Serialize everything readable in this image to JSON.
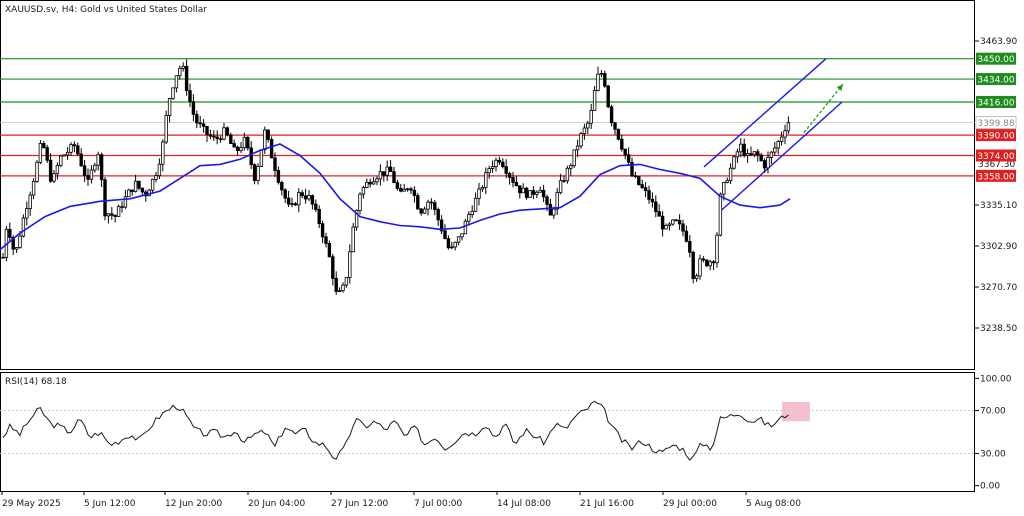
{
  "chart_data": {
    "type": "candlestick",
    "symbol_title": "XAUUSD.sv, H4:  Gold vs United States Dollar",
    "price_axis": {
      "ylim": [
        3206.3,
        3496.1
      ],
      "ticks": [
        "3463.90",
        "3335.10",
        "3302.90",
        "3270.70",
        "3238.50"
      ],
      "extra_ticks": [
        {
          "value": 3367.3,
          "label": "3367.30"
        }
      ]
    },
    "time_axis": {
      "labels": [
        "29 May 2025",
        "5 Jun 12:00",
        "12 Jun 20:00",
        "20 Jun 04:00",
        "27 Jun 12:00",
        "7 Jul 00:00",
        "14 Jul 08:00",
        "21 Jul 16:00",
        "29 Jul 00:00",
        "5 Aug 08:00"
      ]
    },
    "levels": {
      "resistance": [
        {
          "value": 3450.0,
          "label": "3450.00",
          "color": "#1e8c1e"
        },
        {
          "value": 3434.0,
          "label": "3434.00",
          "color": "#1e8c1e"
        },
        {
          "value": 3416.0,
          "label": "3416.00",
          "color": "#1e8c1e"
        }
      ],
      "support": [
        {
          "value": 3390.0,
          "label": "3390.00",
          "color": "#e02020"
        },
        {
          "value": 3374.0,
          "label": "3374.00",
          "color": "#e02020"
        },
        {
          "value": 3358.0,
          "label": "3358.00",
          "color": "#e02020"
        }
      ],
      "current": {
        "value": 3399.88,
        "label": "3399.88",
        "color": "#c0c0c0"
      }
    },
    "price_path": [
      [
        0,
        3273
      ],
      [
        7,
        3322
      ],
      [
        15,
        3295
      ],
      [
        25,
        3330
      ],
      [
        35,
        3360
      ],
      [
        42,
        3386
      ],
      [
        52,
        3352
      ],
      [
        60,
        3372
      ],
      [
        75,
        3382
      ],
      [
        88,
        3352
      ],
      [
        98,
        3378
      ],
      [
        105,
        3330
      ],
      [
        115,
        3326
      ],
      [
        125,
        3340
      ],
      [
        135,
        3352
      ],
      [
        145,
        3343
      ],
      [
        155,
        3358
      ],
      [
        162,
        3378
      ],
      [
        168,
        3415
      ],
      [
        175,
        3436
      ],
      [
        182,
        3446
      ],
      [
        188,
        3422
      ],
      [
        195,
        3402
      ],
      [
        205,
        3392
      ],
      [
        215,
        3386
      ],
      [
        225,
        3393
      ],
      [
        235,
        3376
      ],
      [
        245,
        3386
      ],
      [
        255,
        3356
      ],
      [
        265,
        3393
      ],
      [
        273,
        3370
      ],
      [
        280,
        3352
      ],
      [
        290,
        3330
      ],
      [
        300,
        3345
      ],
      [
        310,
        3340
      ],
      [
        320,
        3320
      ],
      [
        330,
        3292
      ],
      [
        337,
        3262
      ],
      [
        345,
        3272
      ],
      [
        352,
        3312
      ],
      [
        360,
        3345
      ],
      [
        370,
        3355
      ],
      [
        380,
        3360
      ],
      [
        390,
        3362
      ],
      [
        400,
        3342
      ],
      [
        410,
        3352
      ],
      [
        420,
        3330
      ],
      [
        430,
        3340
      ],
      [
        440,
        3320
      ],
      [
        450,
        3298
      ],
      [
        460,
        3310
      ],
      [
        470,
        3330
      ],
      [
        480,
        3346
      ],
      [
        490,
        3366
      ],
      [
        500,
        3372
      ],
      [
        510,
        3358
      ],
      [
        520,
        3347
      ],
      [
        530,
        3343
      ],
      [
        540,
        3350
      ],
      [
        550,
        3325
      ],
      [
        560,
        3350
      ],
      [
        570,
        3366
      ],
      [
        580,
        3388
      ],
      [
        590,
        3402
      ],
      [
        597,
        3435
      ],
      [
        603,
        3440
      ],
      [
        610,
        3405
      ],
      [
        617,
        3392
      ],
      [
        625,
        3375
      ],
      [
        632,
        3358
      ],
      [
        640,
        3350
      ],
      [
        648,
        3342
      ],
      [
        655,
        3332
      ],
      [
        665,
        3315
      ],
      [
        675,
        3322
      ],
      [
        685,
        3313
      ],
      [
        690,
        3300
      ],
      [
        694,
        3276
      ],
      [
        700,
        3290
      ],
      [
        708,
        3290
      ],
      [
        715,
        3294
      ],
      [
        720,
        3340
      ],
      [
        726,
        3355
      ],
      [
        732,
        3366
      ],
      [
        740,
        3382
      ],
      [
        748,
        3372
      ],
      [
        756,
        3376
      ],
      [
        764,
        3366
      ],
      [
        772,
        3376
      ],
      [
        780,
        3387
      ],
      [
        786,
        3398
      ],
      [
        790,
        3402
      ]
    ],
    "ma_line": [
      [
        0,
        3300
      ],
      [
        20,
        3313
      ],
      [
        45,
        3326
      ],
      [
        70,
        3334
      ],
      [
        100,
        3338
      ],
      [
        130,
        3340
      ],
      [
        160,
        3346
      ],
      [
        180,
        3356
      ],
      [
        200,
        3366
      ],
      [
        220,
        3367
      ],
      [
        240,
        3371
      ],
      [
        260,
        3378
      ],
      [
        280,
        3383
      ],
      [
        300,
        3374
      ],
      [
        320,
        3360
      ],
      [
        340,
        3340
      ],
      [
        360,
        3326
      ],
      [
        380,
        3322
      ],
      [
        400,
        3319
      ],
      [
        420,
        3318
      ],
      [
        440,
        3316
      ],
      [
        460,
        3317
      ],
      [
        480,
        3323
      ],
      [
        500,
        3328
      ],
      [
        520,
        3331
      ],
      [
        540,
        3332
      ],
      [
        560,
        3333
      ],
      [
        580,
        3342
      ],
      [
        600,
        3359
      ],
      [
        620,
        3366
      ],
      [
        640,
        3367
      ],
      [
        660,
        3363
      ],
      [
        680,
        3360
      ],
      [
        700,
        3356
      ],
      [
        720,
        3342
      ],
      [
        740,
        3335
      ],
      [
        760,
        3333
      ],
      [
        780,
        3335
      ],
      [
        790,
        3340
      ]
    ],
    "channel_lines": [
      {
        "from": [
          704,
          3365
        ],
        "to": [
          826,
          3450
        ],
        "color": "#1a1ae6"
      },
      {
        "from": [
          720,
          3330
        ],
        "to": [
          842,
          3416
        ],
        "color": "#1a1ae6"
      }
    ],
    "projection_arrow": {
      "from": [
        804,
        3392
      ],
      "to": [
        843,
        3430
      ],
      "color": "#2a9a2a"
    },
    "rsi": {
      "title": "RSI(14) 68.18",
      "ylim": [
        -5,
        105
      ],
      "ticks": [
        "100.00",
        "70.00",
        "30.00",
        "0.00"
      ],
      "levels": [
        70,
        30
      ],
      "highlight": {
        "x_range": [
          782,
          810
        ],
        "y_range": [
          60,
          78
        ],
        "color": "#f7c0cf"
      },
      "series": [
        [
          0,
          42
        ],
        [
          10,
          55
        ],
        [
          20,
          48
        ],
        [
          30,
          62
        ],
        [
          40,
          72
        ],
        [
          50,
          58
        ],
        [
          60,
          55
        ],
        [
          70,
          50
        ],
        [
          80,
          62
        ],
        [
          90,
          45
        ],
        [
          100,
          50
        ],
        [
          110,
          38
        ],
        [
          120,
          42
        ],
        [
          130,
          48
        ],
        [
          140,
          42
        ],
        [
          150,
          55
        ],
        [
          160,
          65
        ],
        [
          170,
          72
        ],
        [
          178,
          75
        ],
        [
          186,
          65
        ],
        [
          195,
          52
        ],
        [
          205,
          48
        ],
        [
          215,
          50
        ],
        [
          225,
          45
        ],
        [
          235,
          52
        ],
        [
          245,
          40
        ],
        [
          255,
          48
        ],
        [
          265,
          50
        ],
        [
          275,
          36
        ],
        [
          285,
          55
        ],
        [
          295,
          48
        ],
        [
          305,
          52
        ],
        [
          315,
          40
        ],
        [
          325,
          38
        ],
        [
          335,
          25
        ],
        [
          345,
          35
        ],
        [
          355,
          62
        ],
        [
          365,
          55
        ],
        [
          375,
          60
        ],
        [
          385,
          52
        ],
        [
          395,
          60
        ],
        [
          405,
          45
        ],
        [
          415,
          55
        ],
        [
          425,
          38
        ],
        [
          435,
          46
        ],
        [
          445,
          35
        ],
        [
          455,
          42
        ],
        [
          465,
          50
        ],
        [
          475,
          48
        ],
        [
          485,
          58
        ],
        [
          495,
          45
        ],
        [
          505,
          58
        ],
        [
          515,
          38
        ],
        [
          525,
          52
        ],
        [
          535,
          46
        ],
        [
          545,
          40
        ],
        [
          555,
          58
        ],
        [
          565,
          52
        ],
        [
          575,
          64
        ],
        [
          585,
          70
        ],
        [
          595,
          78
        ],
        [
          603,
          72
        ],
        [
          612,
          55
        ],
        [
          622,
          42
        ],
        [
          632,
          35
        ],
        [
          642,
          42
        ],
        [
          652,
          35
        ],
        [
          662,
          30
        ],
        [
          672,
          38
        ],
        [
          682,
          35
        ],
        [
          692,
          24
        ],
        [
          702,
          40
        ],
        [
          712,
          35
        ],
        [
          720,
          62
        ],
        [
          730,
          65
        ],
        [
          740,
          68
        ],
        [
          750,
          60
        ],
        [
          760,
          62
        ],
        [
          770,
          55
        ],
        [
          780,
          62
        ],
        [
          786,
          66
        ],
        [
          790,
          70
        ]
      ]
    },
    "colors": {
      "ma": "#1a1ae6",
      "candle": "#000000",
      "rsi_line": "#1a1a1a",
      "grid_dotted": "#c8c8c8",
      "resistance": "#1e8c1e",
      "support": "#e02020"
    }
  }
}
